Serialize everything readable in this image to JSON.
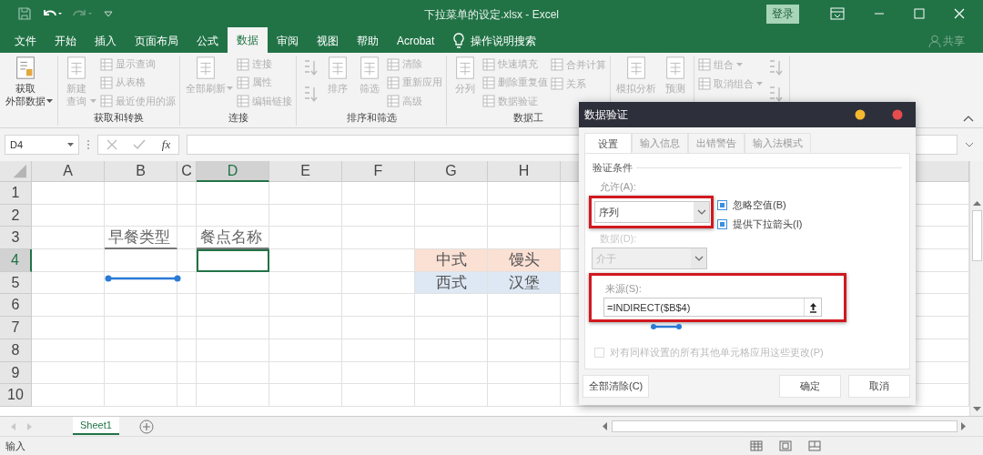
{
  "window": {
    "title": "下拉菜单的设定.xlsx - Excel",
    "sign_in": "登录"
  },
  "menu": {
    "tabs": [
      {
        "label": "文件",
        "selected": false
      },
      {
        "label": "开始",
        "selected": false
      },
      {
        "label": "插入",
        "selected": false
      },
      {
        "label": "页面布局",
        "selected": false
      },
      {
        "label": "公式",
        "selected": false
      },
      {
        "label": "数据",
        "selected": true
      },
      {
        "label": "审阅",
        "selected": false
      },
      {
        "label": "视图",
        "selected": false
      },
      {
        "label": "帮助",
        "selected": false
      },
      {
        "label": "Acrobat",
        "selected": false
      }
    ],
    "search": "操作说明搜索",
    "share": "共享"
  },
  "ribbon": {
    "groups": [
      {
        "columns": [
          [
            {
              "lines": [
                "获取",
                "外部数据"
              ],
              "kind": "large",
              "disabled": false,
              "dropdown": true
            }
          ]
        ]
      },
      {
        "label": "获取和转换",
        "columns": [
          [
            {
              "lines": [
                "新建",
                "查询"
              ],
              "kind": "large",
              "disabled": true,
              "dropdown": true
            }
          ],
          [
            {
              "label": "显示查询",
              "kind": "small",
              "disabled": true
            },
            {
              "label": "从表格",
              "kind": "small",
              "disabled": true
            },
            {
              "label": "最近使用的源",
              "kind": "small",
              "disabled": true
            }
          ]
        ]
      },
      {
        "label": "连接",
        "columns": [
          [
            {
              "lines": [
                "全部刷新"
              ],
              "kind": "large",
              "disabled": true,
              "dropdown": true
            }
          ],
          [
            {
              "label": "连接",
              "kind": "small",
              "disabled": true
            },
            {
              "label": "属性",
              "kind": "small",
              "disabled": true
            },
            {
              "label": "编辑链接",
              "kind": "small",
              "disabled": true
            }
          ]
        ]
      },
      {
        "label": "排序和筛选",
        "columns": [
          [
            {
              "kind": "icon",
              "disabled": true
            },
            {
              "kind": "icon",
              "disabled": true
            }
          ],
          [
            {
              "lines": [
                "排序"
              ],
              "kind": "large",
              "disabled": true
            }
          ],
          [
            {
              "lines": [
                "筛选"
              ],
              "kind": "large",
              "disabled": true
            }
          ],
          [
            {
              "label": "清除",
              "kind": "small",
              "disabled": true
            },
            {
              "label": "重新应用",
              "kind": "small",
              "disabled": true
            },
            {
              "label": "高级",
              "kind": "small",
              "disabled": true
            }
          ]
        ]
      },
      {
        "label": "数据工",
        "columns": [
          [
            {
              "lines": [
                "分列"
              ],
              "kind": "large",
              "disabled": true
            }
          ],
          [
            {
              "label": "快速填充",
              "kind": "small",
              "disabled": true
            },
            {
              "label": "删除重复值",
              "kind": "small",
              "disabled": true
            },
            {
              "label": "数据验证",
              "kind": "small",
              "disabled": true
            }
          ],
          [
            {
              "label": "合并计算",
              "kind": "small",
              "disabled": true
            },
            {
              "label": "关系",
              "kind": "small",
              "disabled": true
            }
          ]
        ]
      },
      {
        "columns": [
          [
            {
              "lines": [
                "模拟分析"
              ],
              "kind": "large",
              "disabled": true
            }
          ],
          [
            {
              "lines": [
                "预测"
              ],
              "kind": "large",
              "disabled": true
            }
          ]
        ]
      },
      {
        "columns": [
          [
            {
              "label": "组合",
              "kind": "small",
              "disabled": true,
              "dropdown": true
            },
            {
              "label": "取消组合",
              "kind": "small",
              "disabled": true,
              "dropdown": true
            }
          ],
          [
            {
              "kind": "icon",
              "disabled": true
            },
            {
              "kind": "icon",
              "disabled": true
            }
          ]
        ]
      }
    ]
  },
  "formula_bar": {
    "name_box": "D4",
    "function_button": "fx"
  },
  "grid": {
    "columns": [
      {
        "label": "A",
        "selected": false
      },
      {
        "label": "B",
        "selected": false
      },
      {
        "label": "C",
        "selected": false
      },
      {
        "label": "D",
        "selected": true
      },
      {
        "label": "E",
        "selected": false
      },
      {
        "label": "F",
        "selected": false
      },
      {
        "label": "G",
        "selected": false
      },
      {
        "label": "H",
        "selected": false
      }
    ],
    "rows": [
      {
        "label": "1",
        "selected": false
      },
      {
        "label": "2",
        "selected": false
      },
      {
        "label": "3",
        "selected": false,
        "cells": {
          "B": {
            "text": "早餐类型",
            "kind": "heading"
          },
          "D": {
            "text": "餐点名称",
            "kind": "heading"
          }
        }
      },
      {
        "label": "4",
        "selected": true,
        "cells": {
          "D": {
            "selected": true
          },
          "G": {
            "text": "中式",
            "color": "#fbe0d4"
          },
          "H": {
            "text": "馒头",
            "color": "#fbe0d4"
          }
        }
      },
      {
        "label": "5",
        "selected": false,
        "cells": {
          "G": {
            "text": "西式",
            "color": "#dde8f4"
          },
          "H": {
            "text": "汉堡",
            "color": "#dde8f4"
          }
        }
      },
      {
        "label": "6",
        "selected": false
      },
      {
        "label": "7",
        "selected": false
      },
      {
        "label": "8",
        "selected": false
      },
      {
        "label": "9",
        "selected": false
      },
      {
        "label": "10",
        "selected": false
      }
    ]
  },
  "sheets": [
    {
      "label": "Sheet1",
      "selected": true
    }
  ],
  "status_bar": {
    "mode": "输入"
  },
  "dialog": {
    "title": "数据验证",
    "tabs": [
      {
        "label": "设置",
        "selected": true
      },
      {
        "label": "输入信息",
        "selected": false
      },
      {
        "label": "出错警告",
        "selected": false
      },
      {
        "label": "输入法模式",
        "selected": false
      }
    ],
    "section": "验证条件",
    "allow": {
      "label": "允许(A):",
      "value": "序列",
      "highlighted": true
    },
    "checkboxes": [
      {
        "label": "忽略空值(B)",
        "checked": true
      },
      {
        "label": "提供下拉箭头(I)",
        "checked": true
      }
    ],
    "data": {
      "label": "数据(D):",
      "value": "介于",
      "disabled": true
    },
    "source": {
      "label": "来源(S):",
      "value": "=INDIRECT($B$4)",
      "highlighted": true
    },
    "apply_all": {
      "label": "对有同样设置的所有其他单元格应用这些更改(P)",
      "checked": false,
      "disabled": true
    },
    "buttons": [
      "全部清除(C)",
      "确定",
      "取消"
    ]
  }
}
